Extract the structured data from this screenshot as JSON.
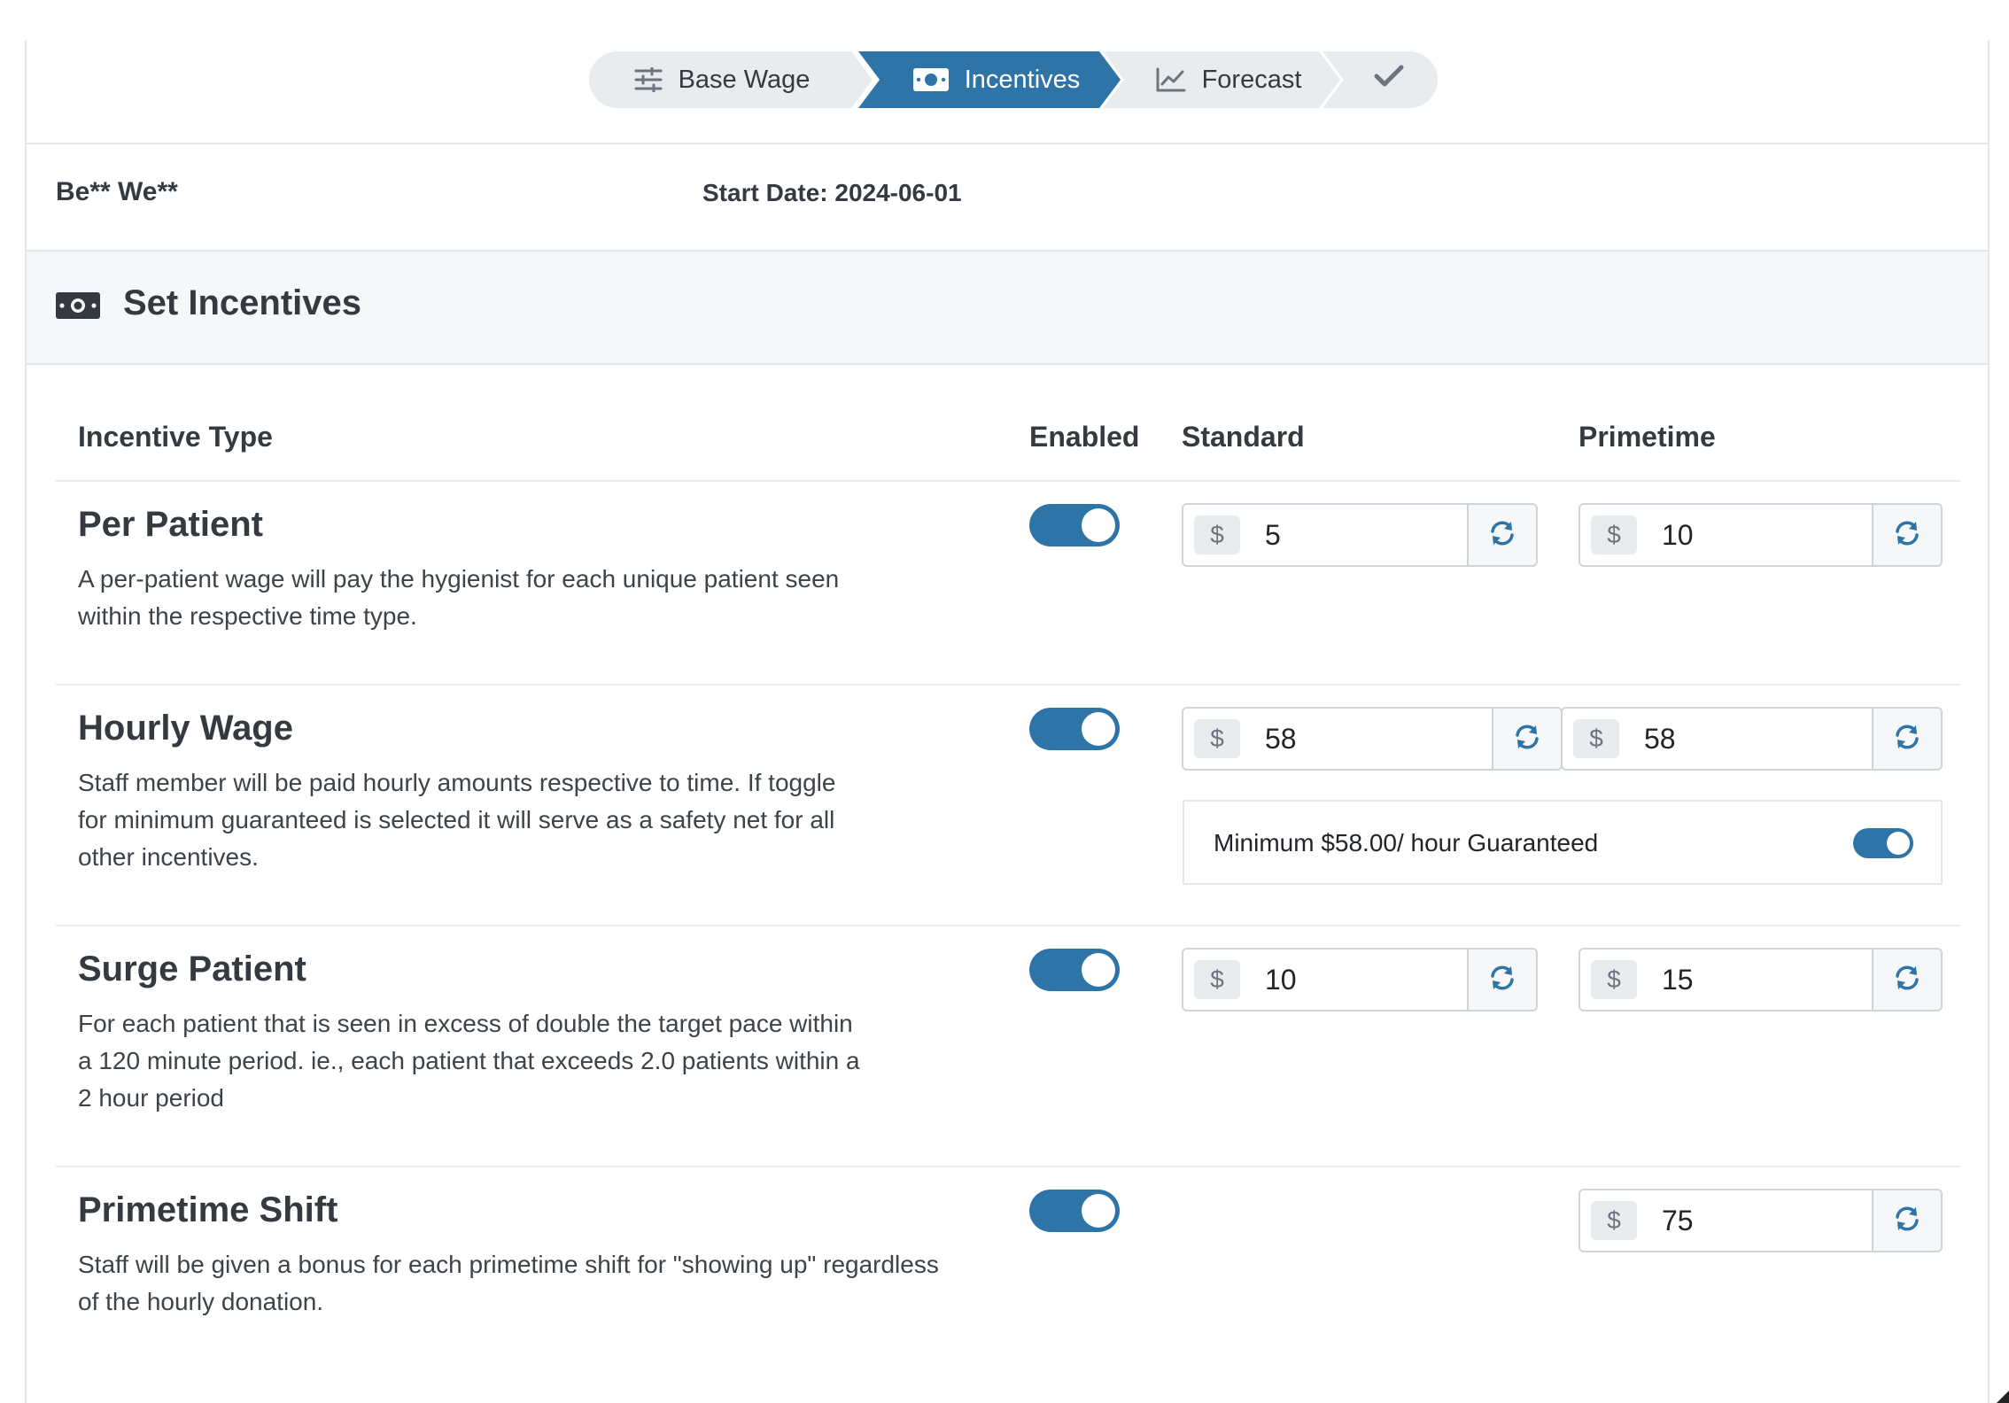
{
  "stepper": {
    "steps": [
      {
        "label": "Base Wage",
        "icon": "sliders-icon",
        "active": false
      },
      {
        "label": "Incentives",
        "icon": "money-bill-icon",
        "active": true
      },
      {
        "label": "Forecast",
        "icon": "chart-line-icon",
        "active": false
      },
      {
        "label": "",
        "icon": "check-icon",
        "active": false
      }
    ]
  },
  "staff": {
    "name": "Be** We**",
    "start_date": "Start Date: 2024-06-01"
  },
  "section": {
    "title": "Set Incentives",
    "icon": "money-bill-icon"
  },
  "table": {
    "headers": {
      "type": "Incentive Type",
      "enabled": "Enabled",
      "standard": "Standard",
      "primetime": "Primetime"
    },
    "currency_symbol": "$",
    "rows": [
      {
        "title": "Per Patient",
        "description_lines": [
          "A per-patient wage will pay the hygienist for each unique patient seen",
          "within the respective time type."
        ],
        "enabled": true,
        "standard": "5",
        "primetime": "10"
      },
      {
        "title": "Hourly Wage",
        "description_lines": [
          "Staff member will be paid hourly amounts respective to time. If toggle",
          "for minimum guaranteed is selected it will serve as a safety net for all",
          "other incentives."
        ],
        "enabled": true,
        "standard": "58",
        "primetime": "58",
        "minimum_guarantee": {
          "label": "Minimum $58.00/ hour Guaranteed",
          "enabled": true
        }
      },
      {
        "title": "Surge Patient",
        "description_lines": [
          "For each patient that is seen in excess of double the target pace within",
          "a 120 minute period. ie., each patient that exceeds 2.0 patients within a",
          "2 hour period"
        ],
        "enabled": true,
        "standard": "10",
        "primetime": "15"
      },
      {
        "title": "Primetime Shift",
        "description_lines": [
          "Staff will be given a bonus for each primetime shift for \"showing up\" regardless",
          "of the hourly donation."
        ],
        "enabled": true,
        "standard": null,
        "primetime": "75"
      }
    ]
  },
  "colors": {
    "accent": "#2f74a6",
    "step_inactive": "#e9ecef",
    "section_bg": "#f5f7f9"
  }
}
